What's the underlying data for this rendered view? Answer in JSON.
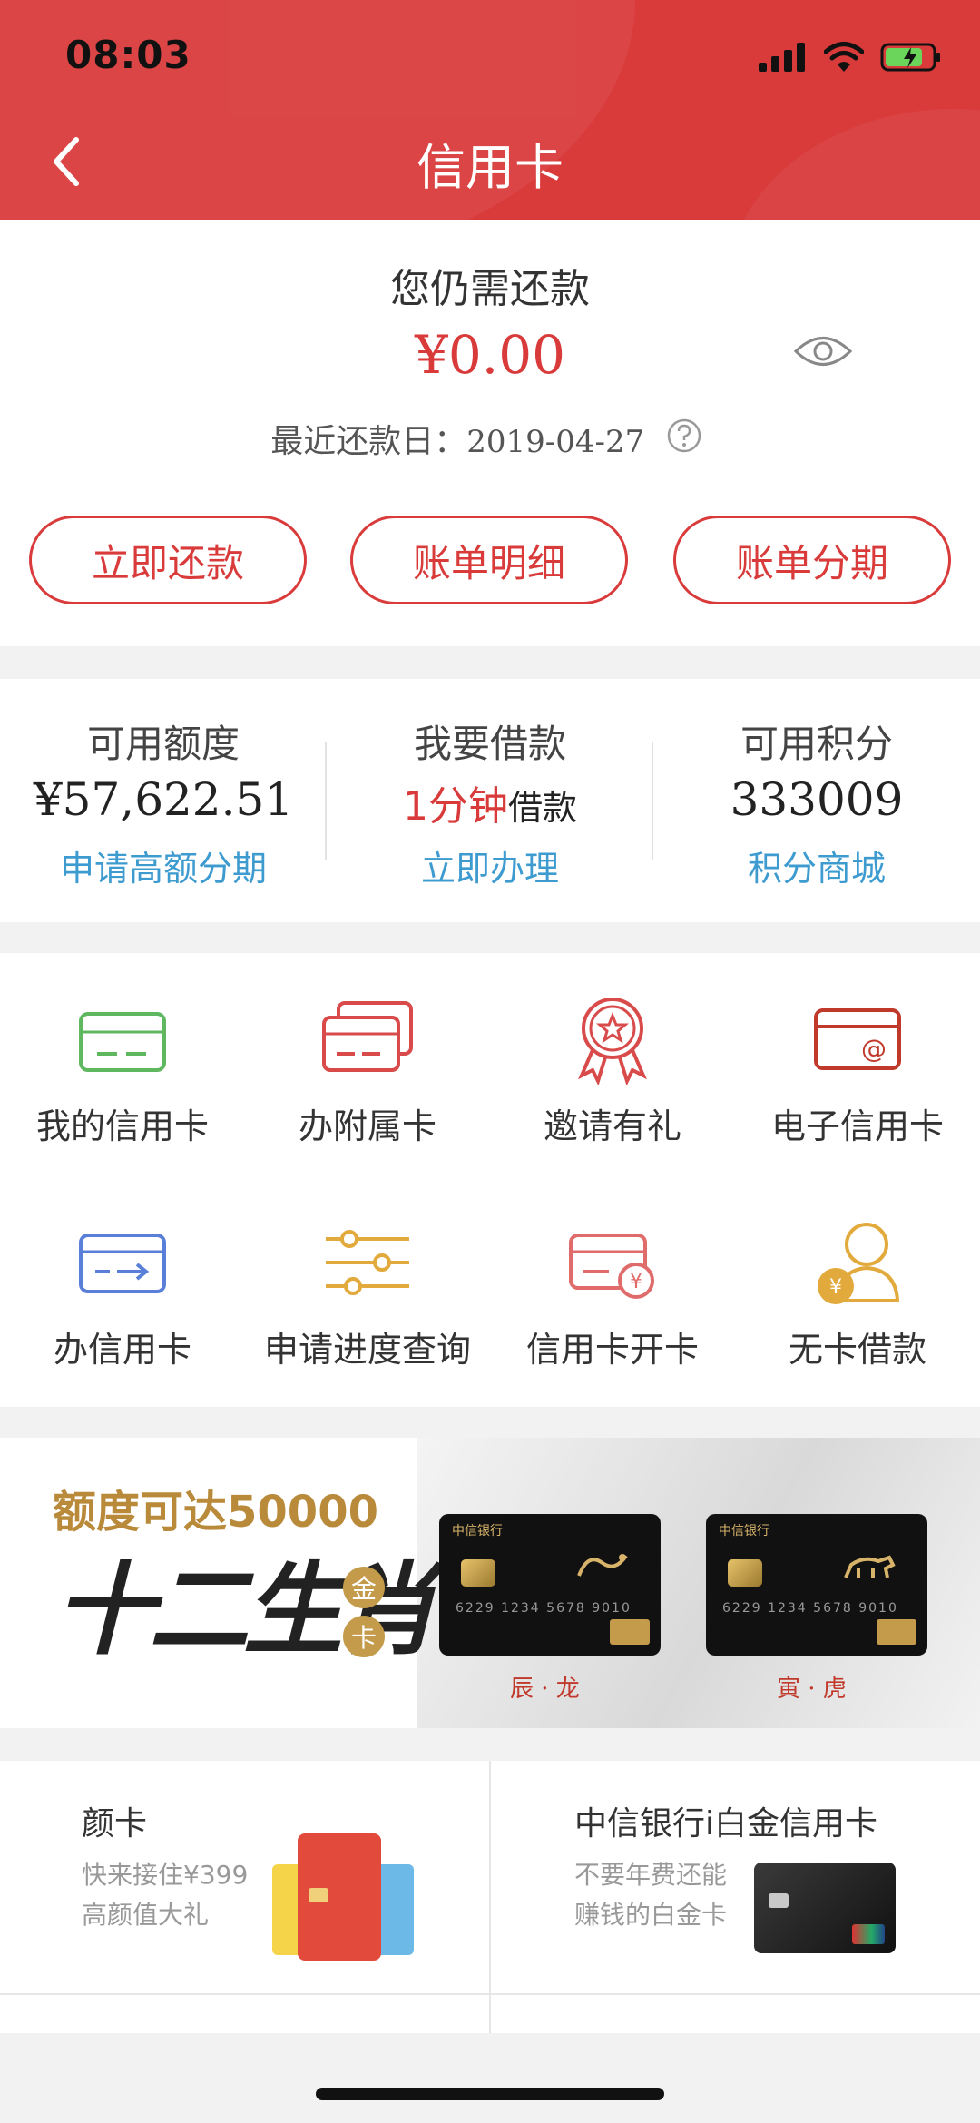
{
  "status_bar": {
    "time": "08:03"
  },
  "header": {
    "title": "信用卡"
  },
  "repay": {
    "title": "您仍需还款",
    "amount": "¥0.00",
    "due_label": "最近还款日：",
    "due_date": "2019-04-27"
  },
  "actions": [
    "立即还款",
    "账单明细",
    "账单分期"
  ],
  "summary": {
    "available_limit": {
      "label": "可用额度",
      "value": "¥57,622.51",
      "link": "申请高额分期"
    },
    "borrow": {
      "label": "我要借款",
      "value_red": "1分钟",
      "value_black": "借款",
      "link": "立即办理"
    },
    "points": {
      "label": "可用积分",
      "value": "333009",
      "link": "积分商城"
    }
  },
  "grid": [
    {
      "label": "我的信用卡",
      "icon": "credit-card-icon"
    },
    {
      "label": "办附属卡",
      "icon": "stacked-cards-icon"
    },
    {
      "label": "邀请有礼",
      "icon": "award-ribbon-icon"
    },
    {
      "label": "电子信用卡",
      "icon": "card-at-icon"
    },
    {
      "label": "办信用卡",
      "icon": "card-arrow-icon"
    },
    {
      "label": "申请进度查询",
      "icon": "sliders-icon"
    },
    {
      "label": "信用卡开卡",
      "icon": "card-yen-icon"
    },
    {
      "label": "无卡借款",
      "icon": "person-yen-icon"
    }
  ],
  "banner": {
    "headline": "额度可达50000",
    "zodiac": "十二生肖",
    "gold1": "金",
    "gold2": "卡",
    "card1_caption": "辰 · 龙",
    "card2_caption": "寅 · 虎",
    "card_bank": "中信银行",
    "card_number": "6229 1234 5678 9010"
  },
  "products": [
    {
      "title": "颜卡",
      "sub1": "快来接住¥399",
      "sub2": "高颜值大礼"
    },
    {
      "title": "中信银行i白金信用卡",
      "sub1": "不要年费还能",
      "sub2": "赚钱的白金卡"
    }
  ],
  "colors": {
    "brand_red": "#d93a3a",
    "link_blue": "#3e9bd0",
    "gold": "#c49a4b"
  }
}
